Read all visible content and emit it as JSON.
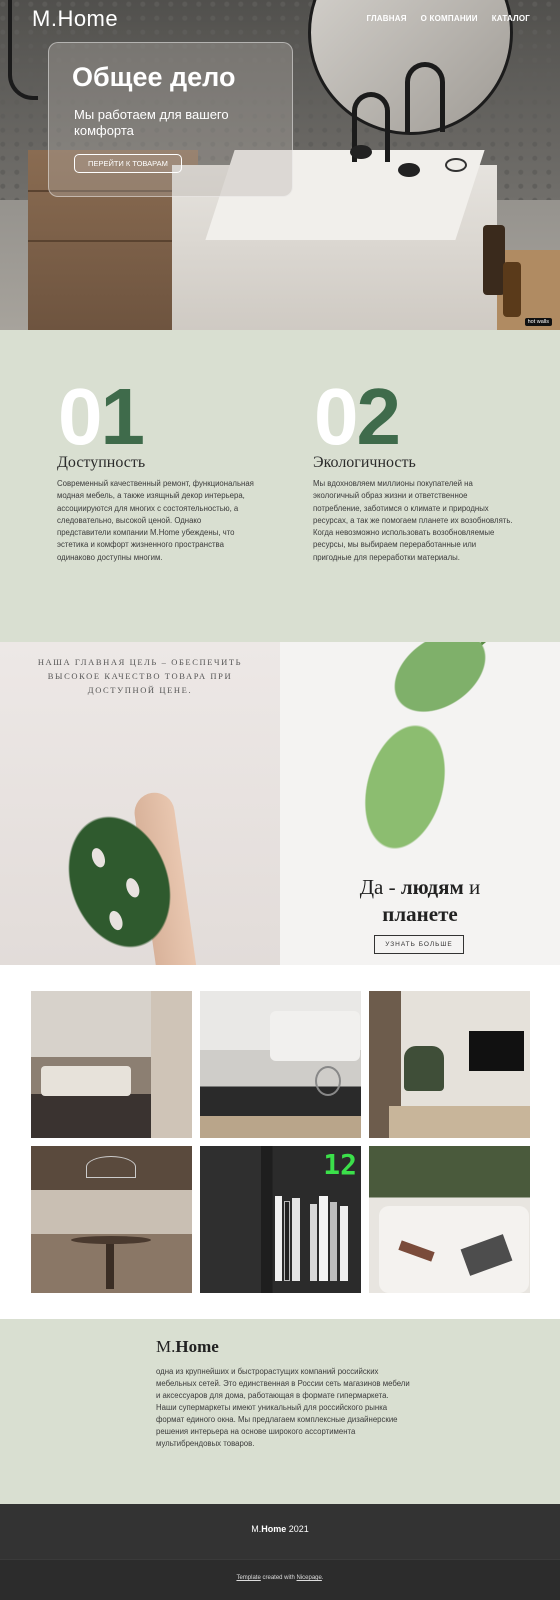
{
  "header": {
    "brand": "M.Home",
    "nav": [
      "ГЛАВНАЯ",
      "О КОМПАНИИ",
      "КАТАЛОГ"
    ]
  },
  "hero": {
    "title": "Общее дело",
    "subtitle": "Мы работаем для вашего комфорта",
    "cta_label": "ПЕРЕЙТИ К ТОВАРАМ",
    "photo_credit": "hot walls"
  },
  "features": [
    {
      "number_first": "0",
      "number_second": "1",
      "title": "Доступность",
      "text": "Современный качественный ремонт, функциональная модная мебель, а также изящный декор интерьера, ассоциируются для многих с состоятельностью, а следовательно, высокой ценой. Однако представители компании M.Home убеждены, что эстетика и комфорт жизненного пространства одинаково доступны многим."
    },
    {
      "number_first": "0",
      "number_second": "2",
      "title": "Экологичность",
      "text": "Мы вдохновляем миллионы покупателей на экологичный образ жизни и ответственное потребление, заботимся о климате и природных ресурсах, а так же помогаем планете их возобновлять.  Когда невозможно использовать возобновляемые ресурсы, мы выбираем переработанные или пригодные для переработки материалы."
    }
  ],
  "mission": {
    "goal": "НАША ГЛАВНАЯ ЦЕЛЬ – ОБЕСПЕЧИТЬ ВЫСОКОЕ КАЧЕСТВО ТОВАРА ПРИ ДОСТУПНОЙ ЦЕНЕ.",
    "slogan_prefix": "Да - ",
    "slogan_bold1": "людям",
    "slogan_mid": " и ",
    "slogan_bold2": "планете",
    "more_label": "УЗНАТЬ БОЛЬШЕ"
  },
  "gallery": {
    "clock_text": "12"
  },
  "about": {
    "title_prefix": "M.",
    "title_bold": "Home",
    "text": "одна из крупнейших и быстрорастущих компаний российских мебельных сетей. Это единственная в России сеть магазинов мебели и аксессуаров для дома, работающая в формате гипермаркета. Наши супермаркеты имеют уникальный для российского рынка формат единого окна. Мы предлагаем комплексные дизайнерские решения интерьера на основе широкого ассортимента мультибрендовых товаров."
  },
  "footer": {
    "brand_prefix": "M.",
    "brand_bold": "Home",
    "year": " 2021",
    "made_template": "Template",
    "made_mid": " created with ",
    "made_tool": "Nicepage",
    "made_end": "."
  },
  "colors": {
    "sage_background": "#d9dfd1",
    "accent_green": "#3f6b4b",
    "footer_dark": "#333333"
  }
}
